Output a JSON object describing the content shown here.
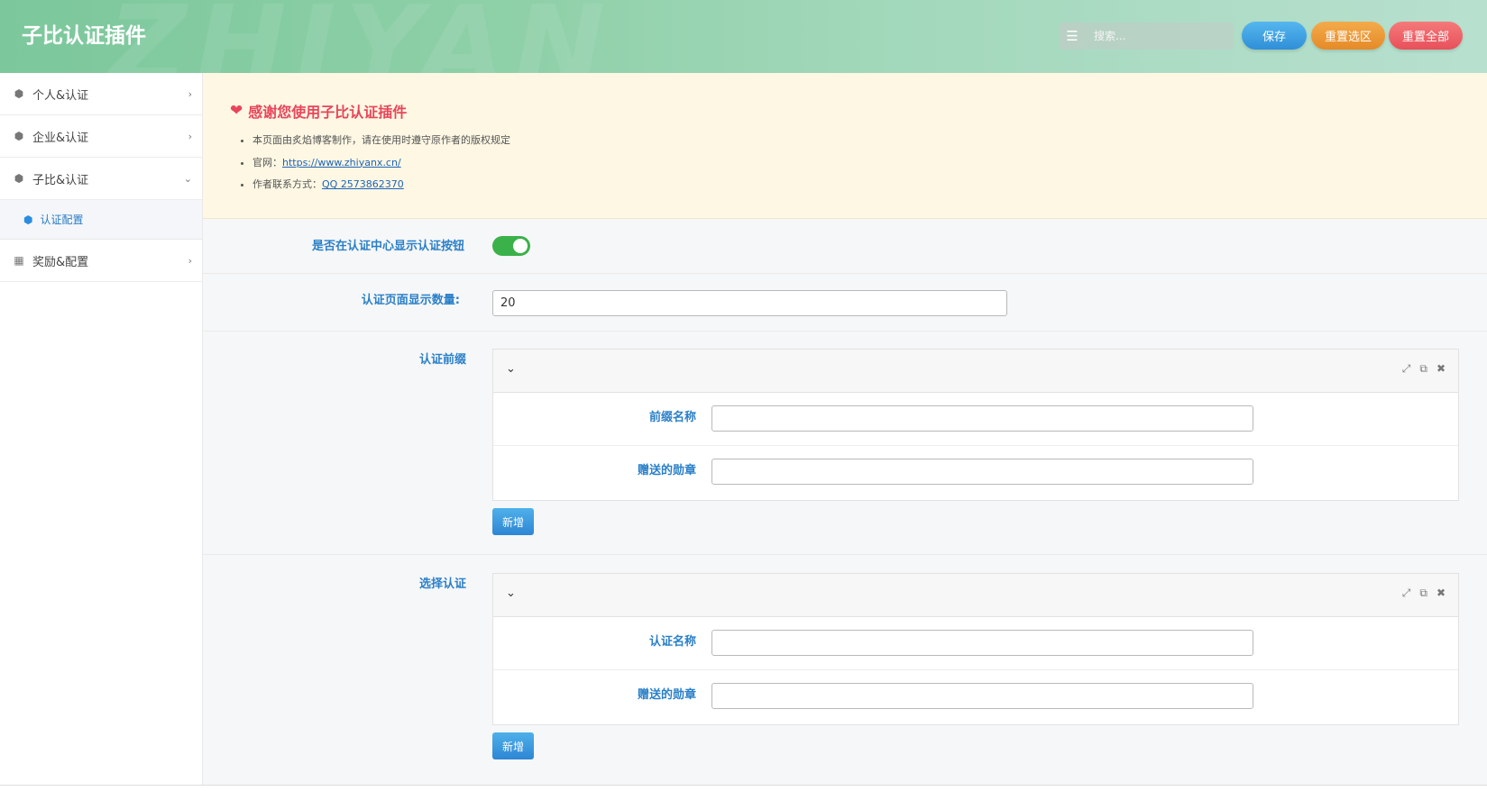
{
  "header": {
    "title": "子比认证插件",
    "search_placeholder": "搜索...",
    "buttons": {
      "save": "保存",
      "reset_section": "重置选区",
      "reset_all": "重置全部"
    },
    "colors": {
      "save": "#3a9fe3",
      "reset_section": "#ec9a36",
      "reset_all": "#ee6068"
    }
  },
  "sidebar": {
    "items": [
      {
        "label": "个人&认证",
        "icon": "cube-icon"
      },
      {
        "label": "企业&认证",
        "icon": "cube-icon"
      },
      {
        "label": "子比&认证",
        "icon": "cube-icon",
        "expanded": true,
        "children": [
          {
            "label": "认证配置",
            "icon": "cube-icon",
            "active": true
          }
        ]
      },
      {
        "label": "奖励&配置",
        "icon": "calendar-icon"
      }
    ]
  },
  "notice": {
    "title": "感谢您使用子比认证插件",
    "line1": "本页面由炙焰博客制作，请在使用时遵守原作者的版权规定",
    "line2_prefix": "官网：",
    "line2_link": "https://www.zhiyanx.cn/",
    "line3_prefix": "作者联系方式：",
    "line3_link": "QQ 2573862370"
  },
  "form": {
    "show_button_label": "是否在认证中心显示认证按钮",
    "show_button_on": true,
    "page_count_label": "认证页面显示数量:",
    "page_count_value": "20",
    "prefix_group": {
      "label": "认证前缀",
      "field1_label": "前缀名称",
      "field2_label": "赠送的勋章",
      "add_label": "新增"
    },
    "select_group": {
      "label": "选择认证",
      "field1_label": "认证名称",
      "field2_label": "赠送的勋章",
      "add_label": "新增"
    }
  }
}
